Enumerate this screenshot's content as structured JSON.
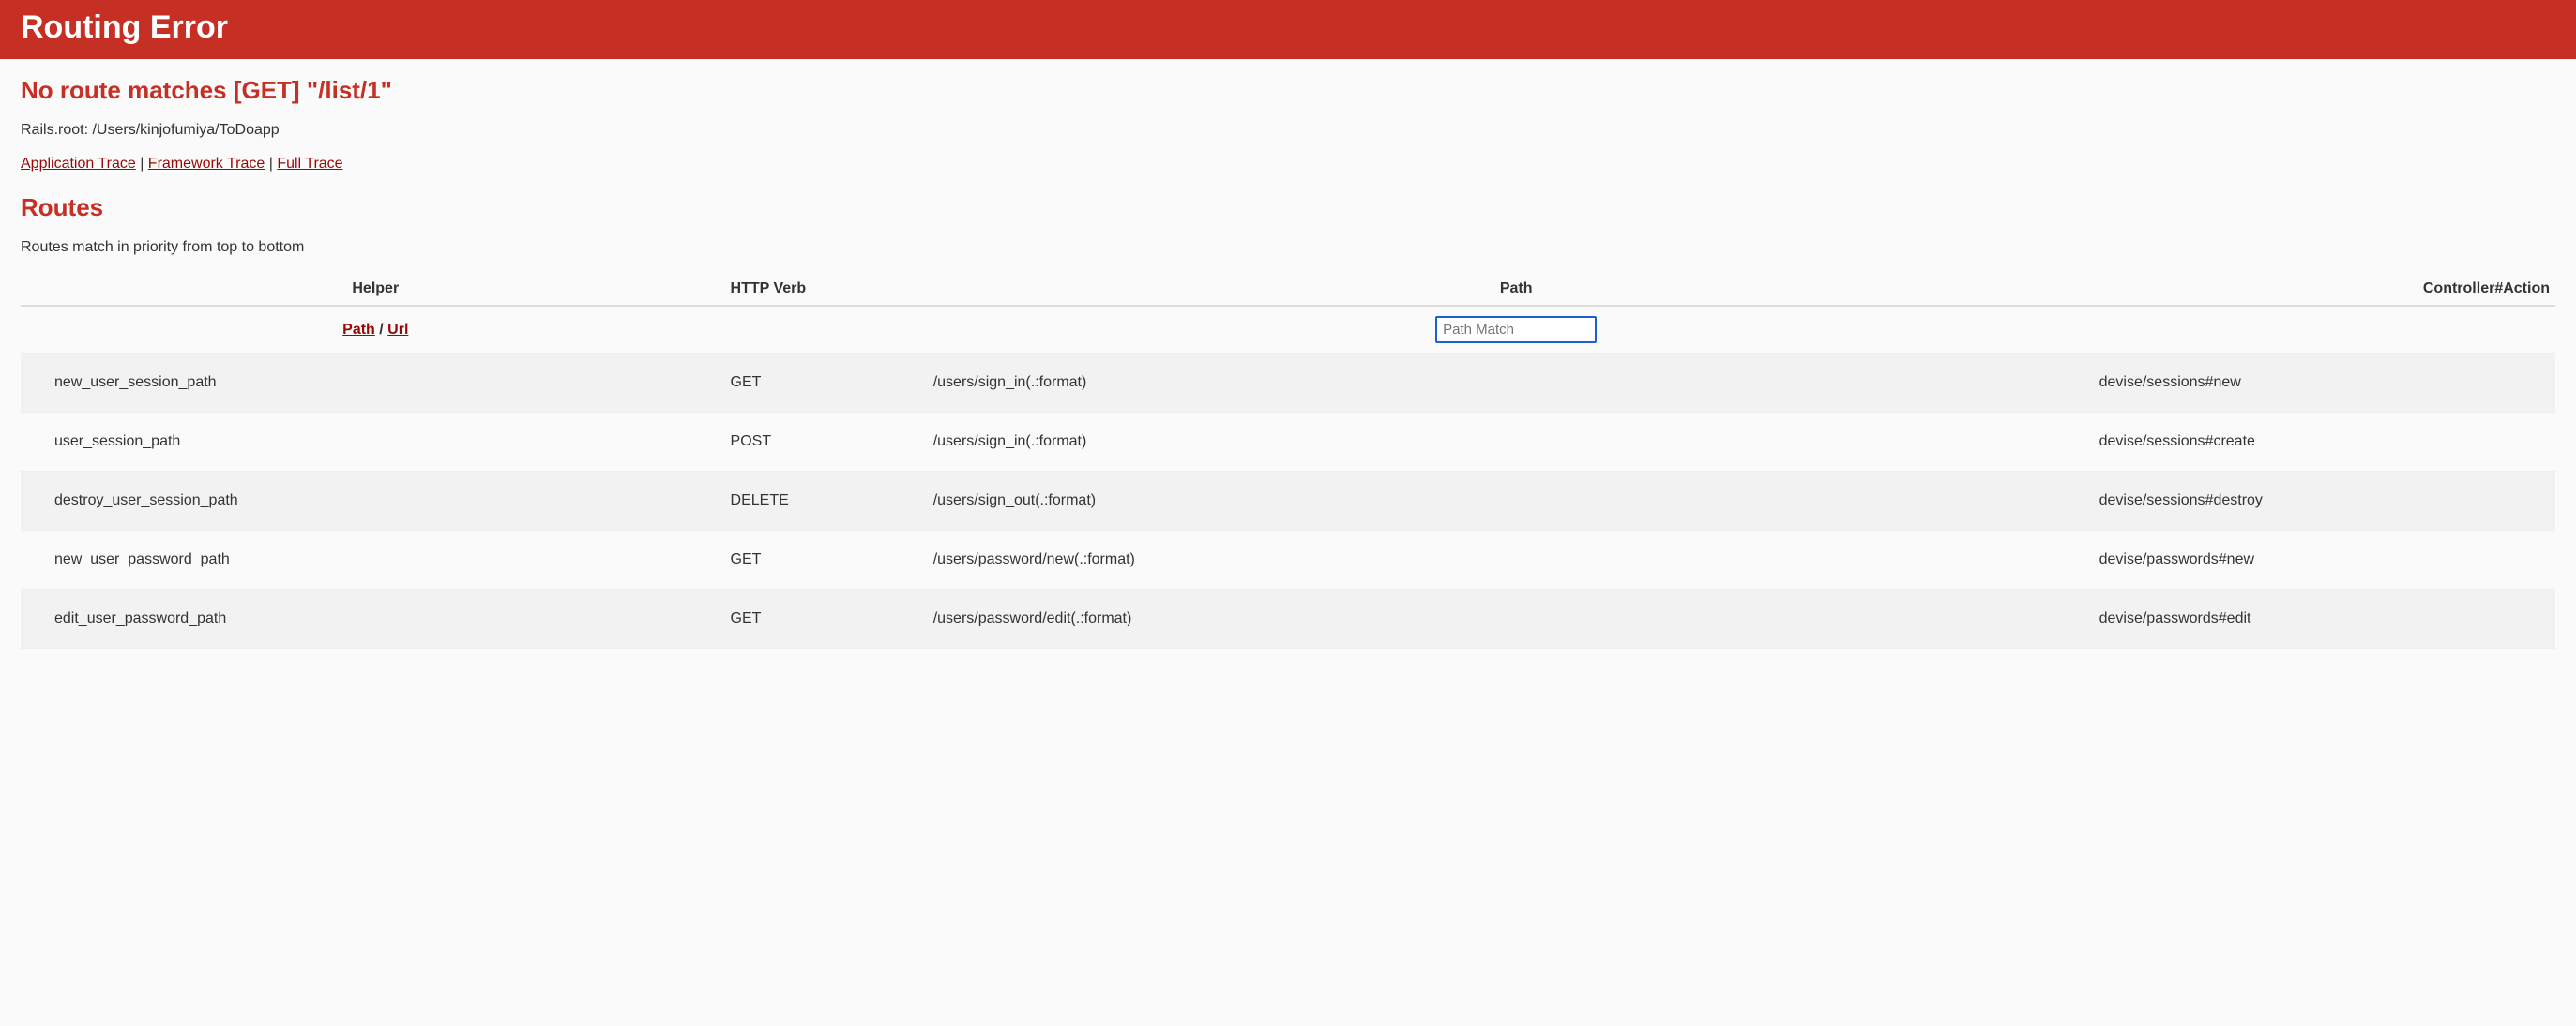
{
  "header": {
    "title": "Routing Error"
  },
  "error": {
    "message": "No route matches [GET] \"/list/1\""
  },
  "rails_root": "Rails.root: /Users/kinjofumiya/ToDoapp",
  "trace": {
    "application": "Application Trace",
    "framework": "Framework Trace",
    "full": "Full Trace"
  },
  "routes": {
    "heading": "Routes",
    "note": "Routes match in priority from top to bottom",
    "columns": {
      "helper": "Helper",
      "verb": "HTTP Verb",
      "path": "Path",
      "action": "Controller#Action"
    },
    "helper_toggle": {
      "path": "Path",
      "url": "Url"
    },
    "path_match_placeholder": "Path Match",
    "rows": [
      {
        "helper": "new_user_session_path",
        "verb": "GET",
        "path": "/users/sign_in(.:format)",
        "action": "devise/sessions#new"
      },
      {
        "helper": "user_session_path",
        "verb": "POST",
        "path": "/users/sign_in(.:format)",
        "action": "devise/sessions#create"
      },
      {
        "helper": "destroy_user_session_path",
        "verb": "DELETE",
        "path": "/users/sign_out(.:format)",
        "action": "devise/sessions#destroy"
      },
      {
        "helper": "new_user_password_path",
        "verb": "GET",
        "path": "/users/password/new(.:format)",
        "action": "devise/passwords#new"
      },
      {
        "helper": "edit_user_password_path",
        "verb": "GET",
        "path": "/users/password/edit(.:format)",
        "action": "devise/passwords#edit"
      }
    ]
  }
}
